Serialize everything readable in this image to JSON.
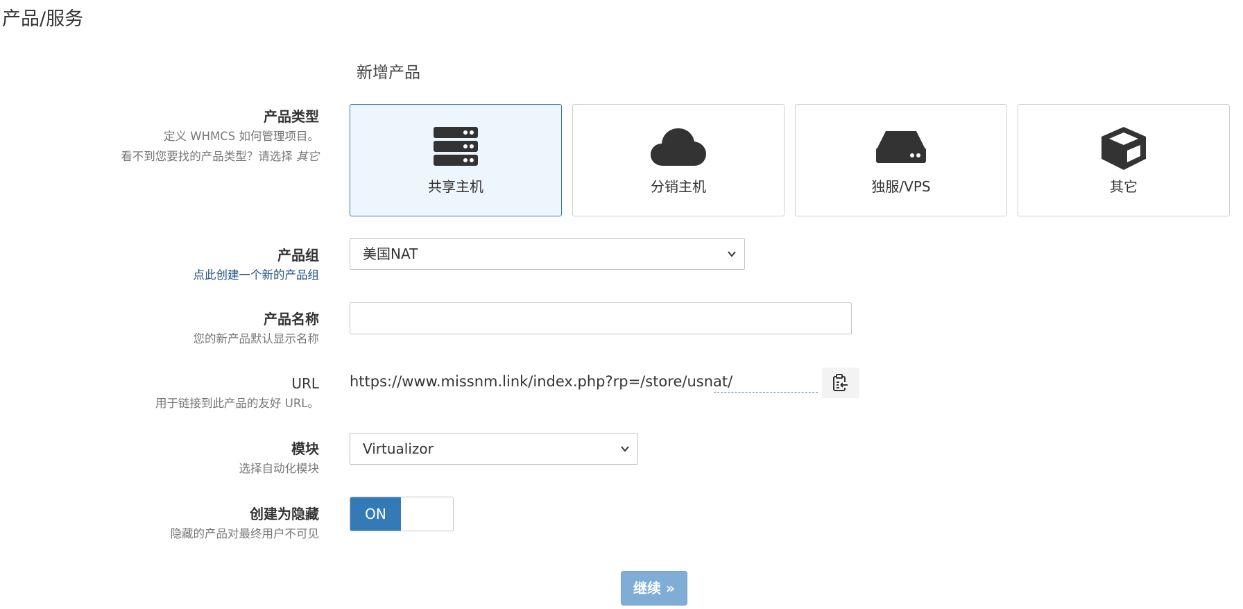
{
  "page": {
    "title": "产品/服务"
  },
  "form": {
    "heading": "新增产品",
    "product_type": {
      "label": "产品类型",
      "help_line1": "定义 WHMCS 如何管理项目。",
      "help_line2_prefix": "看不到您要找的产品类型？请选择 ",
      "help_line2_em": "其它",
      "options": [
        {
          "label": "共享主机",
          "icon": "server-icon",
          "selected": true
        },
        {
          "label": "分销主机",
          "icon": "cloud-icon",
          "selected": false
        },
        {
          "label": "独服/VPS",
          "icon": "hdd-icon",
          "selected": false
        },
        {
          "label": "其它",
          "icon": "cube-icon",
          "selected": false
        }
      ]
    },
    "product_group": {
      "label": "产品组",
      "link": "点此创建一个新的产品组",
      "value": "美国NAT"
    },
    "product_name": {
      "label": "产品名称",
      "help": "您的新产品默认显示名称",
      "value": "",
      "placeholder": ""
    },
    "url": {
      "label": "URL",
      "help": "用于链接到此产品的友好 URL。",
      "prefix": "https://www.missnm.link/index.php?rp=/store/usnat/",
      "slug": ""
    },
    "module": {
      "label": "模块",
      "help": "选择自动化模块",
      "value": "Virtualizor"
    },
    "hidden": {
      "label": "创建为隐藏",
      "help": "隐藏的产品对最终用户不可见",
      "state": "ON"
    },
    "continue_label": "继续 »"
  },
  "colors": {
    "accent": "#337ab7",
    "selected_card_bg": "#eef6fd",
    "continue_button": "#7fadd6",
    "link": "#1f4f8a"
  }
}
